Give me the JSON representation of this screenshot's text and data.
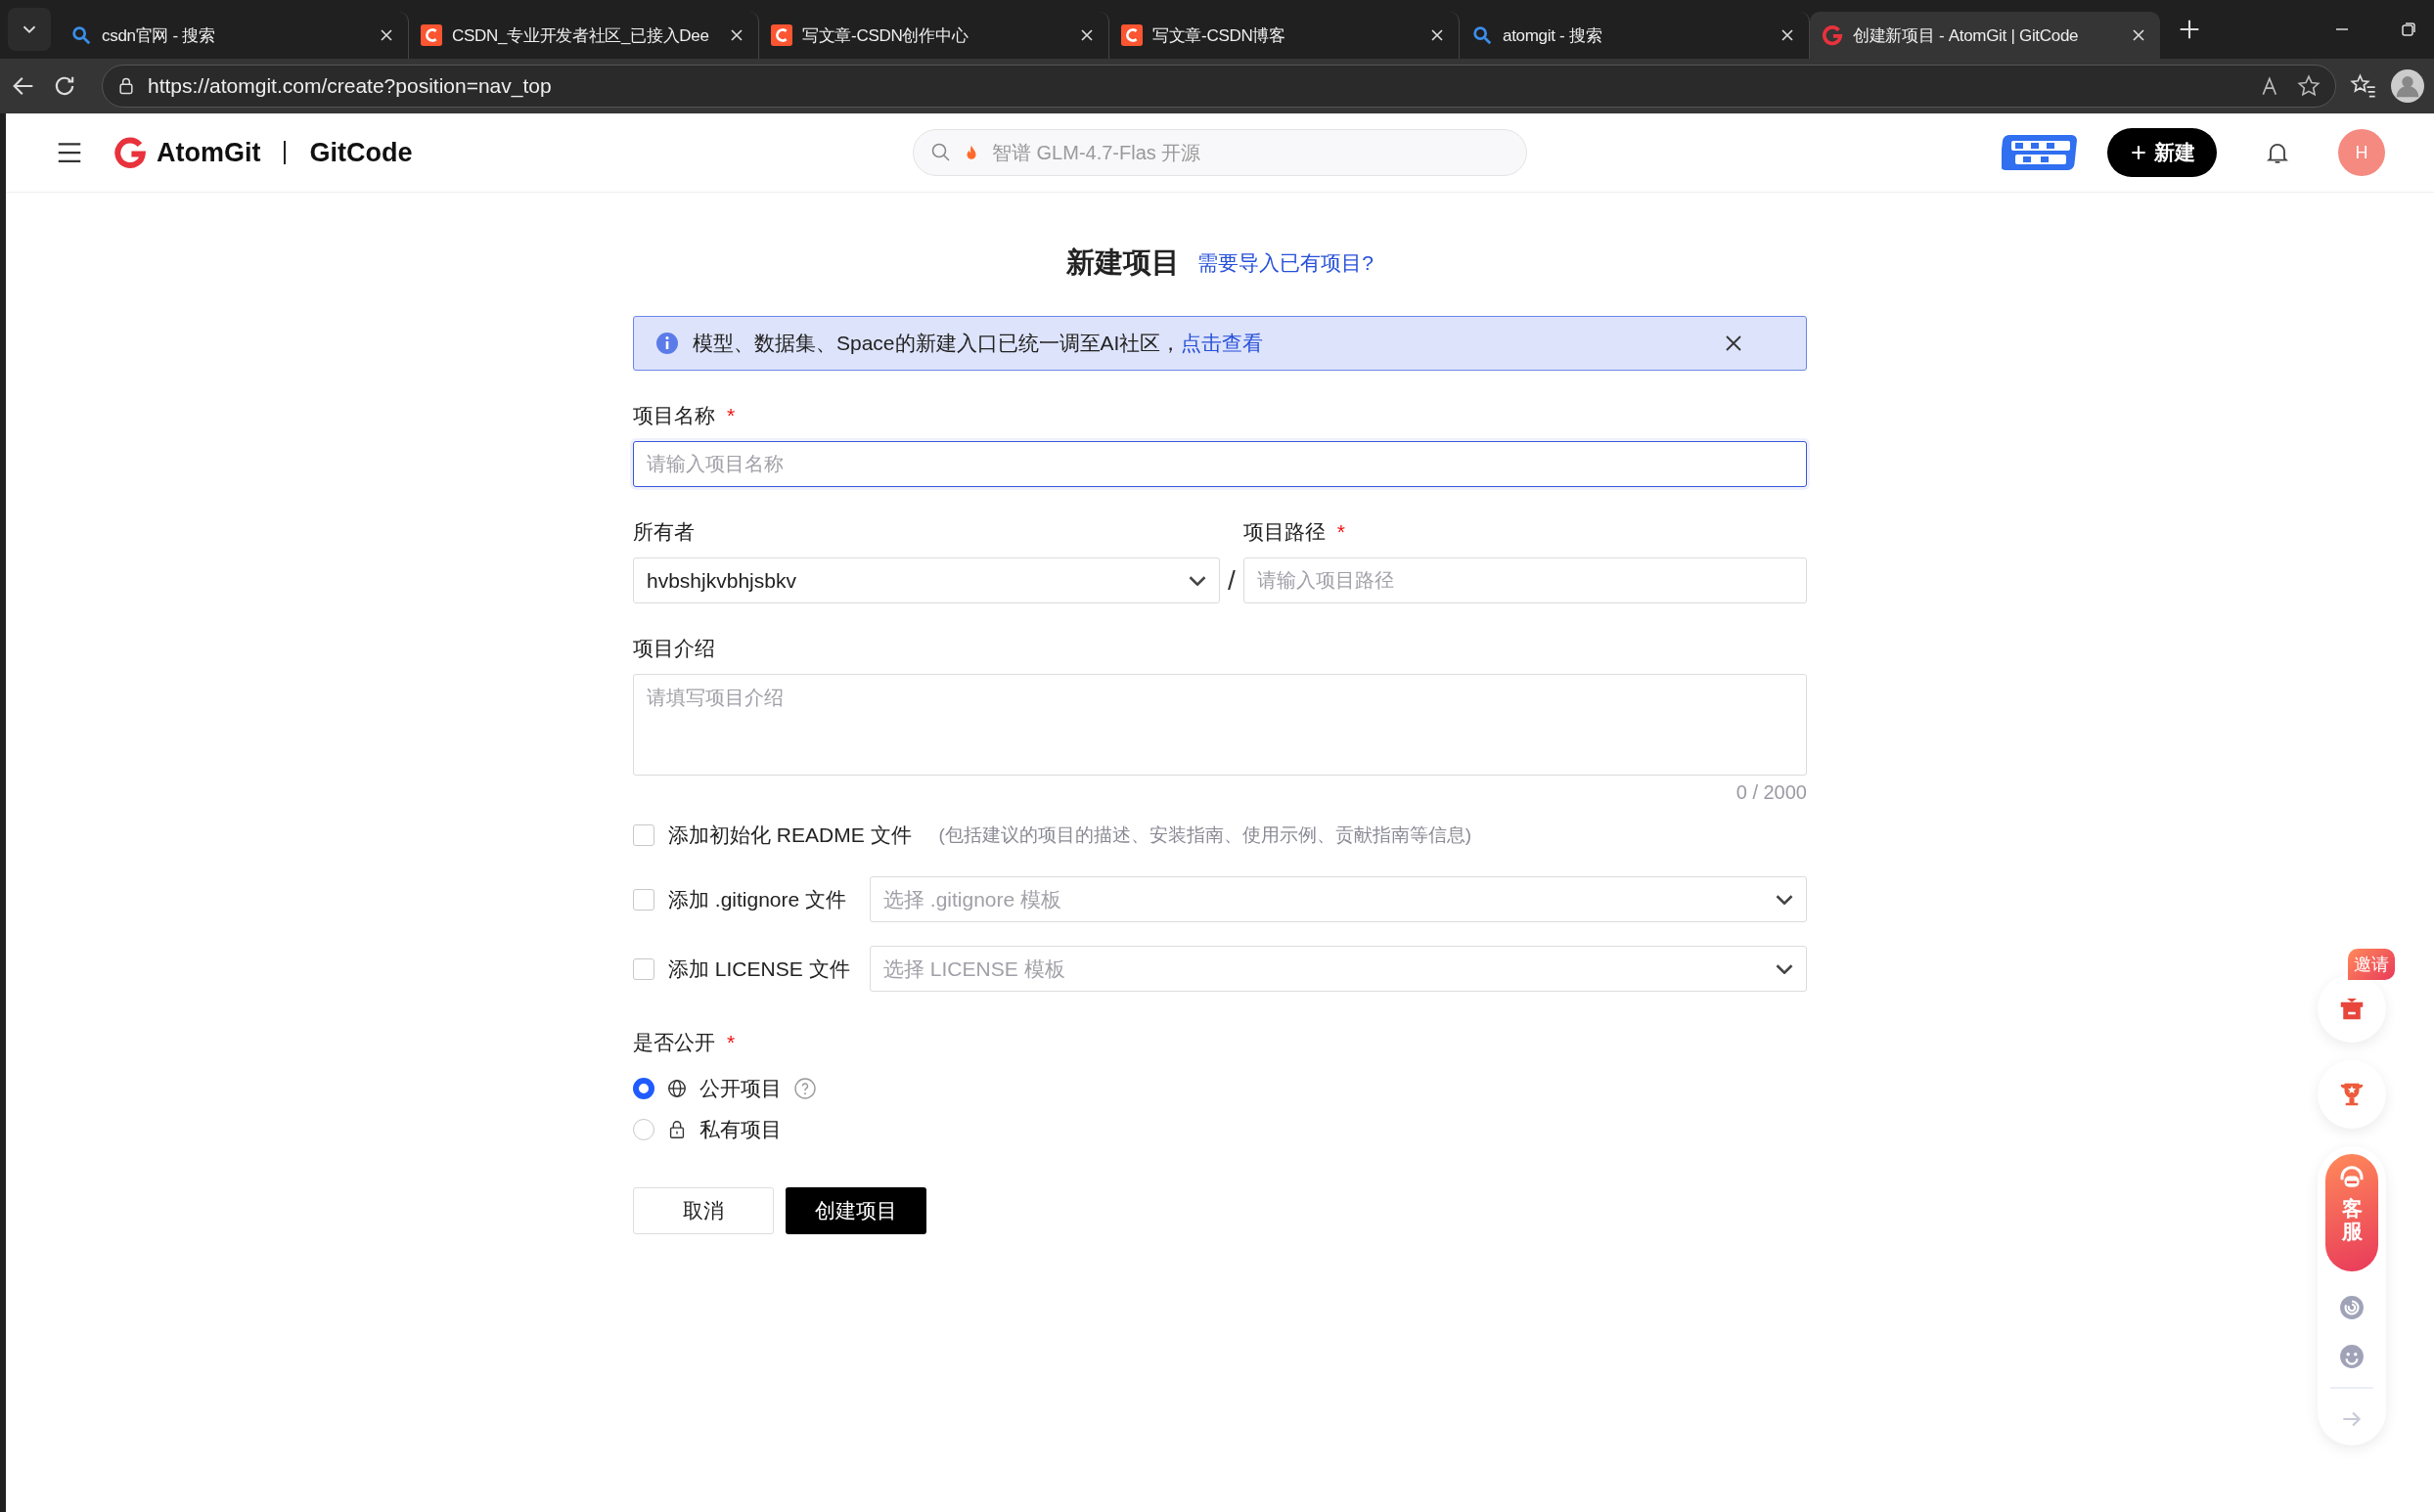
{
  "browser": {
    "tabs": [
      {
        "title": "csdn官网 - 搜索",
        "kind": "search",
        "selected": false
      },
      {
        "title": "CSDN_专业开发者社区_已接入Dee",
        "kind": "csdn",
        "selected": false
      },
      {
        "title": "写文章-CSDN创作中心",
        "kind": "csdn",
        "selected": false
      },
      {
        "title": "写文章-CSDN博客",
        "kind": "csdn",
        "selected": false
      },
      {
        "title": "atomgit - 搜索",
        "kind": "search",
        "selected": false
      },
      {
        "title": "创建新项目 - AtomGit | GitCode",
        "kind": "gitcode",
        "selected": true
      }
    ],
    "url": "https://atomgit.com/create?position=nav_top"
  },
  "header": {
    "brand": "AtomGit",
    "brand_secondary": "GitCode",
    "search_placeholder": "智谱 GLM-4.7-Flas 开源",
    "new_button": "新建",
    "avatar": "H"
  },
  "page": {
    "title": "新建项目",
    "import_link": "需要导入已有项目?"
  },
  "alert": {
    "text": "模型、数据集、Space的新建入口已统一调至AI社区，",
    "link": "点击查看"
  },
  "name_field": {
    "label": "项目名称",
    "required_mark": "*",
    "placeholder": "请输入项目名称",
    "focused": true
  },
  "owner_field": {
    "label": "所有者",
    "value": "hvbshjkvbhjsbkv"
  },
  "path_field": {
    "label": "项目路径",
    "required_mark": "*",
    "separator": "/",
    "placeholder": "请输入项目路径"
  },
  "description_field": {
    "label": "项目介绍",
    "placeholder": "请填写项目介绍",
    "counter": "0 / 2000"
  },
  "options": [
    {
      "kind": "hint",
      "label": "添加初始化 README 文件",
      "hint": "(包括建议的项目的描述、安装指南、使用示例、贡献指南等信息)",
      "checked": false
    },
    {
      "kind": "select",
      "label": "添加 .gitignore 文件",
      "placeholder": "选择 .gitignore 模板",
      "checked": false
    },
    {
      "kind": "select",
      "label": "添加 LICENSE 文件",
      "placeholder": "选择 LICENSE 模板",
      "checked": false
    }
  ],
  "visibility": {
    "label": "是否公开",
    "required_mark": "*",
    "choices": [
      {
        "kind": "public",
        "label": "公开项目",
        "selected": true
      },
      {
        "kind": "private",
        "label": "私有项目",
        "selected": false
      }
    ]
  },
  "buttons": {
    "cancel": "取消",
    "create": "创建项目"
  },
  "floating": {
    "invite_badge": "邀请",
    "service": "客服"
  }
}
